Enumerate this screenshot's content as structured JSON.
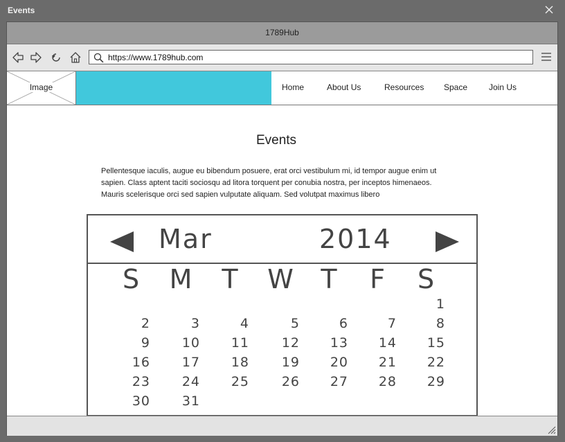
{
  "window": {
    "title": "Events"
  },
  "browser": {
    "tab_title": "1789Hub",
    "url": "https://www.1789hub.com"
  },
  "header": {
    "logo_label": "Image",
    "banner_color": "#41c8dc",
    "nav": [
      "Home",
      "About Us",
      "Resources",
      "Space",
      "Join Us"
    ]
  },
  "page": {
    "heading": "Events",
    "paragraph": "Pellentesque iaculis, augue eu bibendum posuere, erat orci vestibulum mi, id tempor augue enim ut sapien. Class aptent taciti sociosqu ad litora torquent per conubia nostra, per inceptos himenaeos. Mauris scelerisque orci sed sapien vulputate aliquam. Sed volutpat maximus libero"
  },
  "calendar": {
    "month": "Mar",
    "year": "2014",
    "weekdays": [
      "S",
      "M",
      "T",
      "W",
      "T",
      "F",
      "S"
    ],
    "weeks": [
      [
        "",
        "",
        "",
        "",
        "",
        "",
        "1"
      ],
      [
        "2",
        "3",
        "4",
        "5",
        "6",
        "7",
        "8"
      ],
      [
        "9",
        "10",
        "11",
        "12",
        "13",
        "14",
        "15"
      ],
      [
        "16",
        "17",
        "18",
        "19",
        "20",
        "21",
        "22"
      ],
      [
        "23",
        "24",
        "25",
        "26",
        "27",
        "28",
        "29"
      ],
      [
        "30",
        "31",
        "",
        "",
        "",
        "",
        ""
      ]
    ]
  },
  "icons": [
    "close-icon",
    "back-icon",
    "forward-icon",
    "reload-icon",
    "home-icon",
    "search-icon",
    "menu-icon",
    "prev-month-icon",
    "next-month-icon",
    "resize-grip-icon"
  ]
}
